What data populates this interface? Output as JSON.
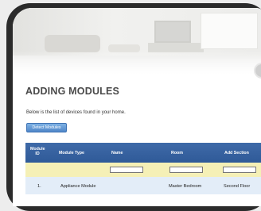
{
  "page": {
    "title": "ADDING MODULES"
  },
  "intro": {
    "text": "Below is the list of devices found in your home."
  },
  "actions": {
    "detect_label": "Detect Modules"
  },
  "table": {
    "headers": [
      "Module ID",
      "Module Type",
      "Name",
      "Room",
      "Add Section"
    ],
    "rows": [
      {
        "id": "1.",
        "type": "Appliance Module",
        "name": "",
        "room": "Master Bedroom",
        "section": "Second Floor"
      }
    ]
  },
  "colors": {
    "header": "#2f5a98",
    "filter_row": "#f5f0b6",
    "row": "#e3edf8",
    "button": "#4f86c8"
  }
}
